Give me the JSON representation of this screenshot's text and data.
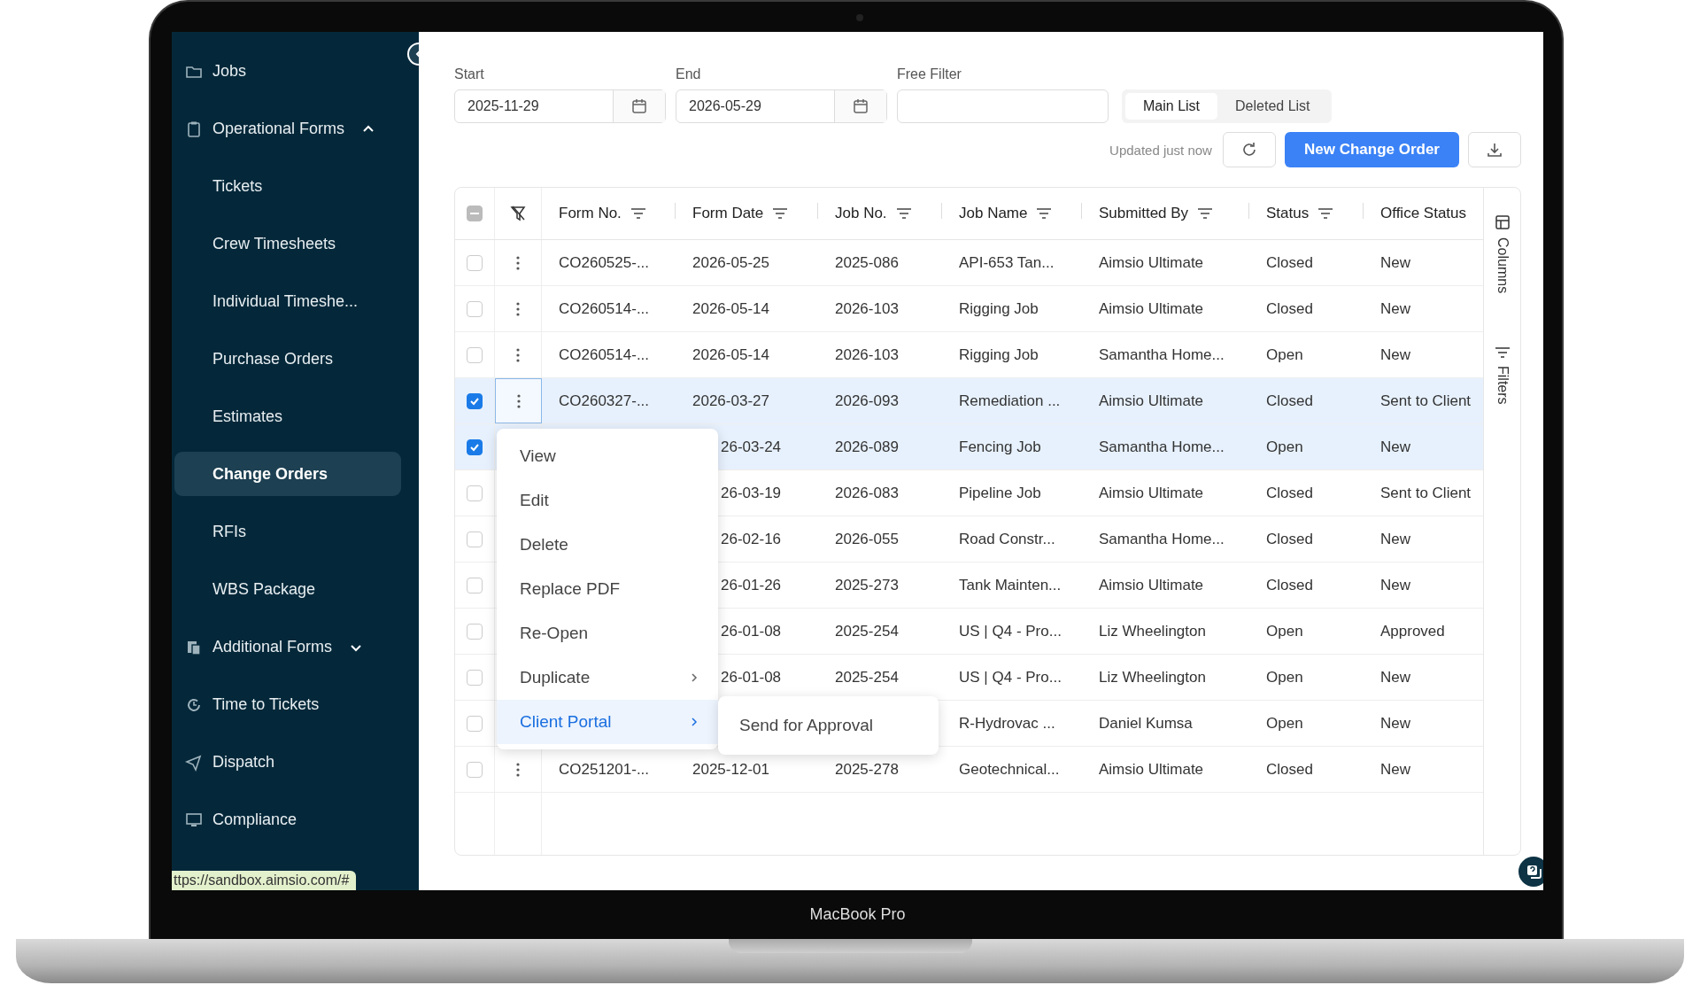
{
  "sidebar": {
    "items": [
      {
        "label": "Jobs",
        "selected": false
      },
      {
        "label": "Operational Forms",
        "selected": false,
        "expanded": true,
        "children": [
          {
            "label": "Tickets",
            "selected": false
          },
          {
            "label": "Crew Timesheets",
            "selected": false
          },
          {
            "label": "Individual Timeshe...",
            "selected": false
          },
          {
            "label": "Purchase Orders",
            "selected": false
          },
          {
            "label": "Estimates",
            "selected": false
          },
          {
            "label": "Change Orders",
            "selected": true
          },
          {
            "label": "RFIs",
            "selected": false
          },
          {
            "label": "WBS Package",
            "selected": false
          }
        ]
      },
      {
        "label": "Additional Forms",
        "selected": false,
        "expanded": false
      },
      {
        "label": "Time to Tickets",
        "selected": false
      },
      {
        "label": "Dispatch",
        "selected": false
      },
      {
        "label": "Compliance",
        "selected": false
      }
    ]
  },
  "link_preview": "ttps://sandbox.aimsio.com/#",
  "filters": [
    {
      "label": "Start",
      "value": "2025-11-29",
      "kind": "date"
    },
    {
      "label": "End",
      "value": "2026-05-29",
      "kind": "date"
    },
    {
      "label": "Free Filter",
      "kind": "text"
    }
  ],
  "list_tabs": [
    {
      "label": "Main List",
      "selected": true
    },
    {
      "label": "Deleted List",
      "selected": false
    }
  ],
  "updated": "Updated just now",
  "new_button": "New Change Order",
  "table": {
    "header_checkbox": {
      "indeterminate": true
    },
    "columns": [
      "Form No.",
      "Form Date",
      "Job No.",
      "Job Name",
      "Submitted By",
      "Status",
      "Office Status"
    ],
    "rows": [
      {
        "selected": false,
        "menu_open": false,
        "form_no": "CO260525-...",
        "form_date": "2026-05-25",
        "job_no": "2025-086",
        "job_name": "API-653 Tan...",
        "submitted_by": "Aimsio Ultimate",
        "status": "Closed",
        "office_status": "New"
      },
      {
        "selected": false,
        "menu_open": false,
        "form_no": "CO260514-...",
        "form_date": "2026-05-14",
        "job_no": "2026-103",
        "job_name": "Rigging Job",
        "submitted_by": "Aimsio Ultimate",
        "status": "Closed",
        "office_status": "New"
      },
      {
        "selected": false,
        "menu_open": false,
        "form_no": "CO260514-...",
        "form_date": "2026-05-14",
        "job_no": "2026-103",
        "job_name": "Rigging Job",
        "submitted_by": "Samantha Home...",
        "status": "Open",
        "office_status": "New"
      },
      {
        "selected": true,
        "menu_open": true,
        "form_no": "CO260327-...",
        "form_date": "2026-03-27",
        "job_no": "2026-093",
        "job_name": "Remediation ...",
        "submitted_by": "Aimsio Ultimate",
        "status": "Closed",
        "office_status": "Sent to Client"
      },
      {
        "selected": true,
        "menu_open": false,
        "form_date": "26-03-24",
        "job_no": "2026-089",
        "job_name": "Fencing Job",
        "submitted_by": "Samantha Home...",
        "status": "Open",
        "office_status": "New"
      },
      {
        "selected": false,
        "menu_open": false,
        "form_date": "26-03-19",
        "job_no": "2026-083",
        "job_name": "Pipeline Job",
        "submitted_by": "Aimsio Ultimate",
        "status": "Closed",
        "office_status": "Sent to Client"
      },
      {
        "selected": false,
        "menu_open": false,
        "form_date": "26-02-16",
        "job_no": "2026-055",
        "job_name": "Road Constr...",
        "submitted_by": "Samantha Home...",
        "status": "Closed",
        "office_status": "New"
      },
      {
        "selected": false,
        "menu_open": false,
        "form_date": "26-01-26",
        "job_no": "2025-273",
        "job_name": "Tank Mainten...",
        "submitted_by": "Aimsio Ultimate",
        "status": "Closed",
        "office_status": "New"
      },
      {
        "selected": false,
        "menu_open": false,
        "form_date": "26-01-08",
        "job_no": "2025-254",
        "job_name": "US | Q4 - Pro...",
        "submitted_by": "Liz Wheelington",
        "status": "Open",
        "office_status": "Approved"
      },
      {
        "selected": false,
        "menu_open": false,
        "form_date": "26-01-08",
        "job_no": "2025-254",
        "job_name": "US | Q4 - Pro...",
        "submitted_by": "Liz Wheelington",
        "status": "Open",
        "office_status": "New"
      },
      {
        "selected": false,
        "menu_open": false,
        "job_name": "R-Hydrovac ...",
        "submitted_by": "Daniel Kumsa",
        "status": "Open",
        "office_status": "New"
      },
      {
        "selected": false,
        "menu_open": false,
        "form_no": "CO251201-...",
        "form_date": "2025-12-01",
        "job_no": "2025-278",
        "job_name": "Geotechnical...",
        "submitted_by": "Aimsio Ultimate",
        "status": "Closed",
        "office_status": "New"
      }
    ]
  },
  "side_tabs": [
    "Columns",
    "Filters"
  ],
  "context_menu": {
    "items": [
      {
        "label": "View",
        "submenu": false,
        "selected": false
      },
      {
        "label": "Edit",
        "submenu": false,
        "selected": false
      },
      {
        "label": "Delete",
        "submenu": false,
        "selected": false
      },
      {
        "label": "Replace PDF",
        "submenu": false,
        "selected": false
      },
      {
        "label": "Re-Open",
        "submenu": false,
        "selected": false
      },
      {
        "label": "Duplicate",
        "submenu": true,
        "selected": false
      },
      {
        "label": "Client Portal",
        "submenu": true,
        "selected": true
      }
    ],
    "submenu": [
      "Send for Approval"
    ]
  },
  "laptop_label": "MacBook Pro"
}
